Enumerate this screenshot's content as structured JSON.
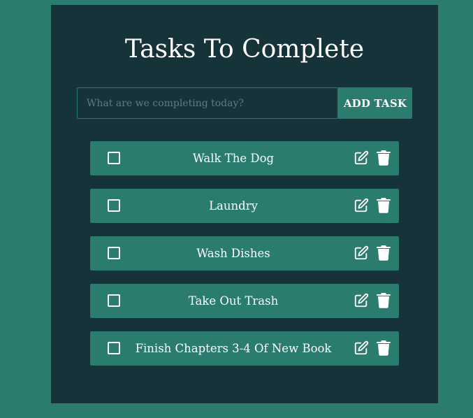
{
  "app": {
    "title": "Tasks To Complete"
  },
  "form": {
    "input_value": "",
    "input_placeholder": "What are we completing today?",
    "add_button_label": "ADD TASK"
  },
  "todos": [
    {
      "text": "Walk The Dog",
      "completed": false,
      "edit_icon": "edit-icon",
      "delete_icon": "trash-icon"
    },
    {
      "text": "Laundry",
      "completed": false,
      "edit_icon": "edit-icon",
      "delete_icon": "trash-icon"
    },
    {
      "text": "Wash Dishes",
      "completed": false,
      "edit_icon": "edit-icon",
      "delete_icon": "trash-icon"
    },
    {
      "text": "Take Out Trash",
      "completed": false,
      "edit_icon": "edit-icon",
      "delete_icon": "trash-icon"
    },
    {
      "text": "Finish Chapters 3-4 Of New Book",
      "completed": false,
      "edit_icon": "edit-icon",
      "delete_icon": "trash-icon"
    }
  ],
  "colors": {
    "page_background": "#2a7c6f",
    "panel_background": "#17333a",
    "accent": "#2a7c6f",
    "text": "#ffffff",
    "placeholder": "#5f7b80"
  }
}
